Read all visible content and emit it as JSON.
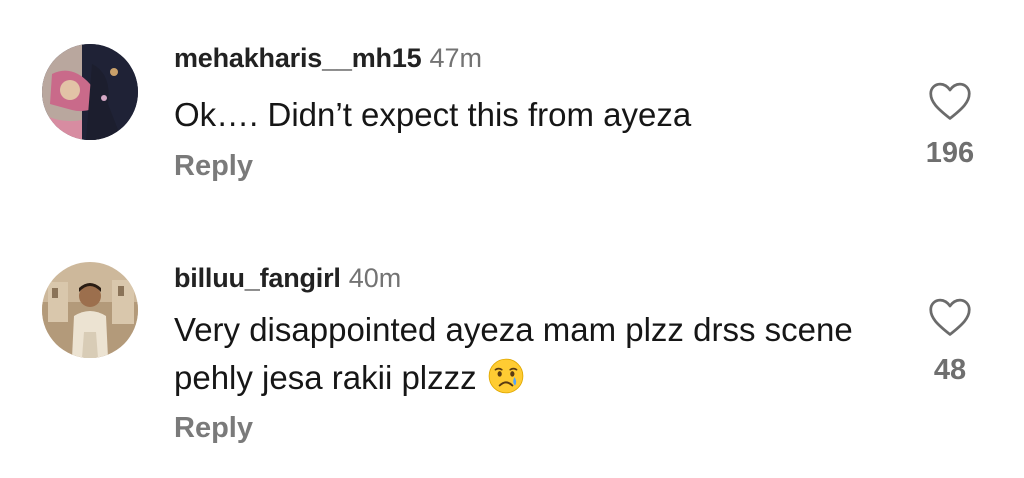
{
  "comments": [
    {
      "username": "mehakharis__mh15",
      "time": "47m",
      "text": "Ok…. Didn’t expect this from ayeza",
      "reply_label": "Reply",
      "like_count": "196",
      "like_icon": "heart-outline-icon"
    },
    {
      "username": "billuu_fangirl",
      "time": "40m",
      "text": "Very disappointed ayeza mam plzz drss scene pehly jesa rakii plzzz",
      "emoji": "crying-face-emoji",
      "reply_label": "Reply",
      "like_count": "48",
      "like_icon": "heart-outline-icon"
    }
  ],
  "colors": {
    "text_primary": "#161616",
    "text_secondary": "#737373",
    "background": "#ffffff"
  }
}
